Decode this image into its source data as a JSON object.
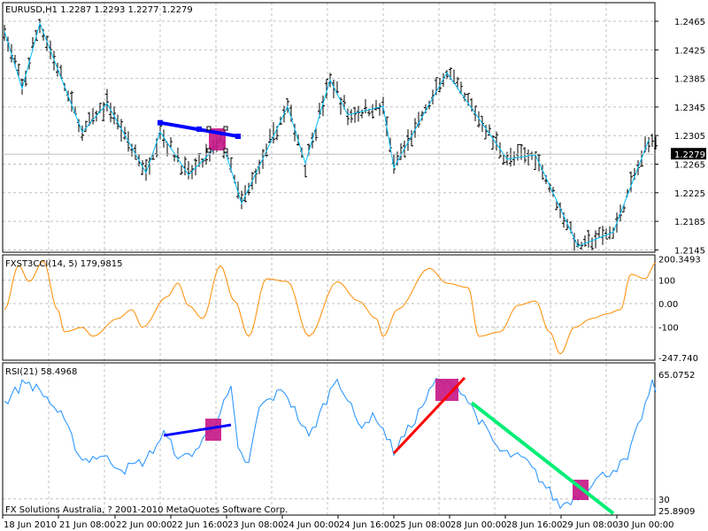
{
  "main": {
    "title": "EURUSD,H1  1.2287 1.2293 1.2277 1.2279",
    "current_price": "1.2279",
    "price_ticks": [
      "1.2465",
      "1.2425",
      "1.2385",
      "1.2345",
      "1.2305",
      "1.2265",
      "1.2225",
      "1.2185",
      "1.2145"
    ],
    "zigzag": [
      [
        0,
        1.2451
      ],
      [
        5,
        1.2371
      ],
      [
        10,
        1.2462
      ],
      [
        22,
        1.231
      ],
      [
        29,
        1.235
      ],
      [
        40,
        1.2253
      ],
      [
        44,
        1.231
      ],
      [
        52,
        1.225
      ],
      [
        60,
        1.229
      ],
      [
        61,
        1.2305
      ],
      [
        67,
        1.221
      ],
      [
        80,
        1.2346
      ],
      [
        85,
        1.2266
      ],
      [
        92,
        1.2383
      ],
      [
        97,
        1.2334
      ],
      [
        107,
        1.2346
      ],
      [
        110,
        1.226
      ],
      [
        125,
        1.2393
      ],
      [
        142,
        1.2272
      ],
      [
        150,
        1.2278
      ],
      [
        162,
        1.215
      ],
      [
        172,
        1.217
      ],
      [
        182,
        1.2299
      ]
    ],
    "last_close": 1.2279
  },
  "cci": {
    "title": "FXST3CCI(14, 5) 179,9815",
    "ticks": [
      "200.3493",
      "100",
      "0.00",
      "-100",
      "-247.740"
    ],
    "points": [
      [
        0,
        -26
      ],
      [
        4,
        162
      ],
      [
        7,
        94
      ],
      [
        11,
        181
      ],
      [
        15,
        -26
      ],
      [
        17,
        -121
      ],
      [
        22,
        -102
      ],
      [
        25,
        -140
      ],
      [
        32,
        -64
      ],
      [
        36,
        -26
      ],
      [
        39,
        -102
      ],
      [
        46,
        30
      ],
      [
        49,
        87
      ],
      [
        52,
        -8
      ],
      [
        56,
        -64
      ],
      [
        61,
        162
      ],
      [
        65,
        11
      ],
      [
        69,
        -140
      ],
      [
        74,
        106
      ],
      [
        80,
        94
      ],
      [
        86,
        -140
      ],
      [
        94,
        94
      ],
      [
        100,
        11
      ],
      [
        105,
        -64
      ],
      [
        107,
        -140
      ],
      [
        111,
        -26
      ],
      [
        120,
        151
      ],
      [
        125,
        87
      ],
      [
        131,
        68
      ],
      [
        134,
        -140
      ],
      [
        140,
        -121
      ],
      [
        145,
        -8
      ],
      [
        150,
        11
      ],
      [
        154,
        -121
      ],
      [
        157,
        -215
      ],
      [
        161,
        -102
      ],
      [
        166,
        -64
      ],
      [
        170,
        -45
      ],
      [
        174,
        -26
      ],
      [
        177,
        125
      ],
      [
        181,
        106
      ],
      [
        184,
        174
      ]
    ],
    "color": "#ff8c00"
  },
  "rsi": {
    "title": "RSI(21) 58.4968",
    "ticks": [
      "65.0752",
      "30",
      "25.8909"
    ],
    "points": [
      [
        0,
        56.5
      ],
      [
        6,
        62.6
      ],
      [
        11,
        59
      ],
      [
        16,
        52.9
      ],
      [
        22,
        40.7
      ],
      [
        27,
        42
      ],
      [
        34,
        38.2
      ],
      [
        40,
        40.7
      ],
      [
        45,
        48
      ],
      [
        50,
        40.7
      ],
      [
        55,
        44.3
      ],
      [
        61,
        54
      ],
      [
        64,
        60.2
      ],
      [
        66,
        43.1
      ],
      [
        69,
        39.5
      ],
      [
        72,
        55.3
      ],
      [
        79,
        60.2
      ],
      [
        86,
        46.8
      ],
      [
        94,
        63.9
      ],
      [
        100,
        50.4
      ],
      [
        105,
        52.9
      ],
      [
        110,
        43.1
      ],
      [
        115,
        50.4
      ],
      [
        122,
        62.6
      ],
      [
        129,
        60.2
      ],
      [
        135,
        50.4
      ],
      [
        140,
        43.1
      ],
      [
        147,
        40.7
      ],
      [
        152,
        34.6
      ],
      [
        157,
        28
      ],
      [
        162,
        31
      ],
      [
        166,
        34.6
      ],
      [
        172,
        38.2
      ],
      [
        176,
        40.7
      ],
      [
        180,
        52.9
      ],
      [
        183,
        61.4
      ],
      [
        184,
        60.2
      ]
    ],
    "color": "#1e90ff"
  },
  "trendlines": {
    "main_blue": {
      "from": [
        44,
        1.2323
      ],
      "to": [
        66,
        1.2304
      ],
      "color": "#0000ff"
    },
    "rsi_blue": {
      "from": [
        45,
        47.5
      ],
      "to": [
        64,
        50.4
      ],
      "color": "#0000ff"
    },
    "rsi_red": {
      "from": [
        110,
        42.6
      ],
      "to": [
        130,
        63.4
      ],
      "color": "#ff0000"
    },
    "rsi_green": {
      "from": [
        132,
        56.5
      ],
      "to": [
        172,
        26
      ],
      "color": "#00ee76"
    }
  },
  "markers_color": "#c71585",
  "copyright": "FX Solutions Australia, ? 2001-2010 MetaQuotes Software Corp.",
  "time_labels": [
    "18 Jun 2010",
    "21 Jun 08:00",
    "22 Jun 00:00",
    "22 Jun 16:00",
    "23 Jun 08:00",
    "24 Jun 00:00",
    "24 Jun 16:00",
    "25 Jun 08:00",
    "28 Jun 00:00",
    "28 Jun 16:00",
    "29 Jun 08:00",
    "30 Jun 00:00"
  ]
}
